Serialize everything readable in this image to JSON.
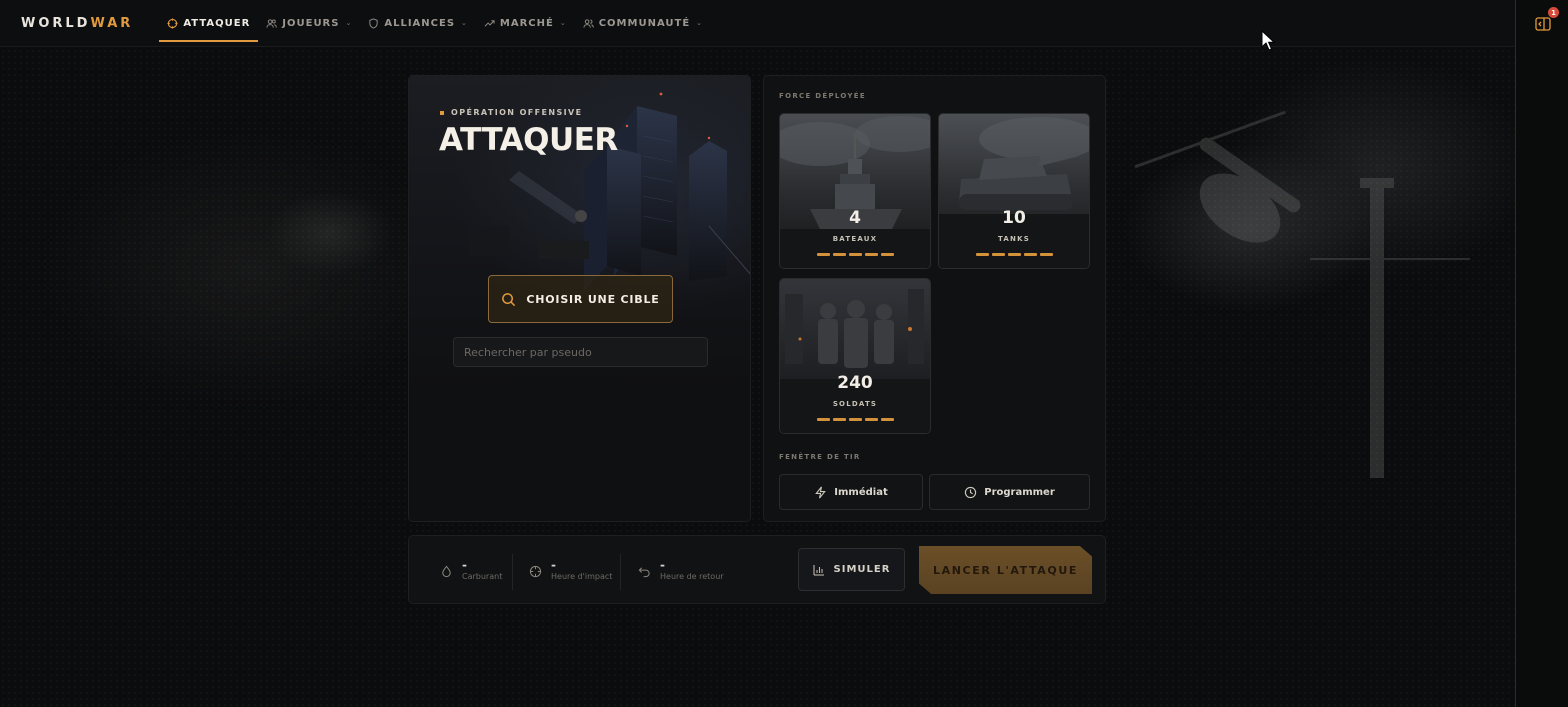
{
  "brand": {
    "part1": "WORLD",
    "part2": "WAR"
  },
  "nav": {
    "items": [
      {
        "label": "ATTAQUER",
        "icon": "crosshair-icon",
        "active": true
      },
      {
        "label": "JOUEURS",
        "icon": "users-icon",
        "active": false
      },
      {
        "label": "ALLIANCES",
        "icon": "shield-icon",
        "active": false
      },
      {
        "label": "MARCHÉ",
        "icon": "trending-up-icon",
        "active": false
      },
      {
        "label": "COMMUNAUTÉ",
        "icon": "community-icon",
        "active": false
      }
    ]
  },
  "side_panel": {
    "badge": "1",
    "icon": "panel-toggle-icon"
  },
  "attack": {
    "eyebrow": "OPÉRATION OFFENSIVE",
    "title": "ATTAQUER",
    "choose_target": "CHOISIR UNE CIBLE",
    "search_placeholder": "Rechercher par pseudo"
  },
  "force": {
    "label": "FORCE DÉPLOYÉE",
    "units": [
      {
        "count": "4",
        "name": "BATEAUX",
        "level": 5,
        "image": "warship"
      },
      {
        "count": "10",
        "name": "TANKS",
        "level": 5,
        "image": "tank"
      },
      {
        "count": "240",
        "name": "SOLDATS",
        "level": 5,
        "image": "soldiers"
      }
    ]
  },
  "fire_window": {
    "label": "FENÊTRE DE TIR",
    "immediate": "Immédiat",
    "schedule": "Programmer"
  },
  "bottom": {
    "fuel": {
      "value": "-",
      "label": "Carburant"
    },
    "impact": {
      "value": "-",
      "label": "Heure d'impact"
    },
    "return": {
      "value": "-",
      "label": "Heure de retour"
    },
    "simulate": "SIMULER",
    "launch": "LANCER L'ATTAQUE"
  },
  "colors": {
    "accent": "#e29a3e",
    "launch_bg": "#5f4624",
    "background": "#0b0c0d"
  }
}
